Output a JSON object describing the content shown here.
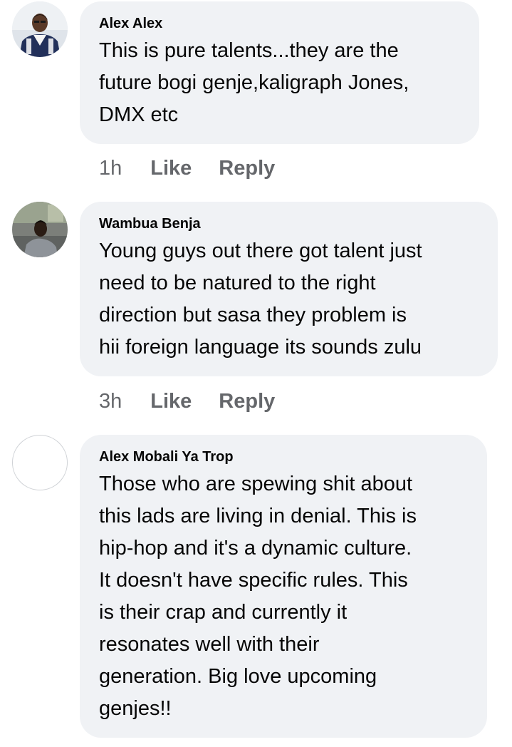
{
  "comments": [
    {
      "author": "Alex Alex",
      "text_lines": [
        "This is pure talents...they are the",
        "future bogi genje,kaligraph Jones,",
        "DMX etc"
      ],
      "time": "1h",
      "like_label": "Like",
      "reply_label": "Reply",
      "avatar_icon": "profile-photo"
    },
    {
      "author": "Wambua Benja",
      "text_lines": [
        "Young guys out there got talent just",
        "need to be natured to the right",
        "direction but sasa they problem is",
        "hii foreign language its sounds zulu"
      ],
      "time": "3h",
      "like_label": "Like",
      "reply_label": "Reply",
      "avatar_icon": "profile-photo"
    },
    {
      "author": "Alex Mobali Ya Trop",
      "text_lines": [
        "Those who are spewing shit about",
        "this lads are living in denial. This is",
        "hip-hop and it's a dynamic culture.",
        "It doesn't have specific rules. This",
        "is their crap and currently it",
        "resonates well with their",
        "generation. Big love upcoming",
        "genjes!!"
      ],
      "avatar_icon": "empty-avatar"
    }
  ],
  "colors": {
    "bubble_bg": "#f0f2f5",
    "text": "#050505",
    "secondary": "#65676b"
  }
}
